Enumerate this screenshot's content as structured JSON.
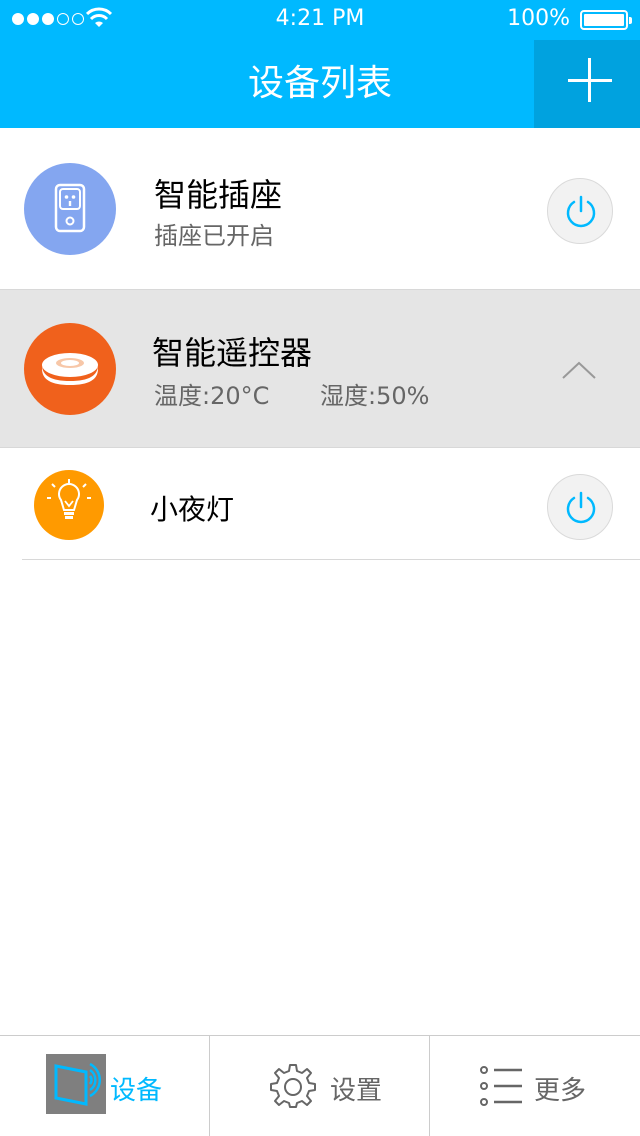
{
  "status_bar": {
    "time": "4:21 PM",
    "battery_text": "100%",
    "battery_level": 1.0,
    "signal_bars_filled": 3,
    "signal_bars_total": 5
  },
  "nav": {
    "title": "设备列表",
    "background": "#00B9FF",
    "add_button_active_color": "#00A2DF",
    "add_icon": "plus-icon"
  },
  "devices": [
    {
      "name": "智能插座",
      "status": "插座已开启",
      "icon": "power-socket-icon",
      "icon_color": "#84A6F0",
      "action_icon": "power-icon"
    },
    {
      "name": "智能遥控器",
      "temperature": "温度:20°C",
      "humidity": "湿度:50%",
      "icon": "remote-hub-icon",
      "icon_color": "#F0611C",
      "row_color": "#E5E5E5",
      "expand_icon": "chevron-up-icon"
    },
    {
      "name": "小夜灯",
      "icon": "light-bulb-icon",
      "icon_color": "#FF9A00",
      "action_icon": "power-icon"
    }
  ],
  "divider_color": "#D8D8D8",
  "tabbar": {
    "border_color": "#CCCCCC",
    "active_color": "#00B9FF",
    "inactive_color": "#666666",
    "tabs": [
      {
        "label": "设备",
        "icon": "devices-icon"
      },
      {
        "label": "设置",
        "icon": "gear-icon"
      },
      {
        "label": "更多",
        "icon": "list-icon"
      }
    ]
  }
}
